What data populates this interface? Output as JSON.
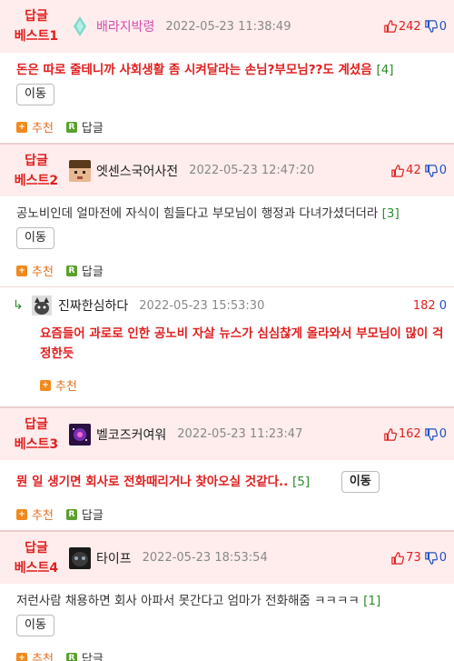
{
  "comments": [
    {
      "badge_line1": "답글",
      "badge_line2": "베스트1",
      "avatar_icon": "diamond-icon",
      "username": "배라지박령",
      "timestamp": "2022-05-23 11:38:49",
      "up": "242",
      "down": "0",
      "text": "돈은 따로 줄테니까 사회생활 좀 시켜달라는 손님?부모님??도 계셨음",
      "reply_count": "[4]",
      "move_label": "이동",
      "recommend_label": "추천",
      "reply_label": "답글"
    },
    {
      "badge_line1": "답글",
      "badge_line2": "베스트2",
      "avatar_icon": "pixel-face-icon",
      "username": "엣센스국어사전",
      "timestamp": "2022-05-23 12:47:20",
      "up": "42",
      "down": "0",
      "text": "공노비인데 얼마전에 자식이 힘들다고 부모님이 행정과 다녀가셨더더라",
      "reply_count": "[3]",
      "move_label": "이동",
      "recommend_label": "추천",
      "reply_label": "답글"
    },
    {
      "badge_line1": "답글",
      "badge_line2": "베스트3",
      "avatar_icon": "galaxy-icon",
      "username": "벨코즈커여워",
      "timestamp": "2022-05-23 11:23:47",
      "up": "162",
      "down": "0",
      "text": "뭔 일 생기면 회사로 전화때리거나 찾아오실 것같다..",
      "reply_count": "[5]",
      "move_label": "이동",
      "recommend_label": "추천",
      "reply_label": "답글"
    },
    {
      "badge_line1": "답글",
      "badge_line2": "베스트4",
      "avatar_icon": "dark-face-icon",
      "username": "타이프",
      "timestamp": "2022-05-23 18:53:54",
      "up": "73",
      "down": "0",
      "text": "저런사람 채용하면 회사 아파서 못간다고 엄마가 전화해줌 ㅋㅋㅋㅋ",
      "reply_count": "[1]",
      "move_label": "이동",
      "recommend_label": "추천",
      "reply_label": "답글"
    }
  ],
  "reply": {
    "avatar_icon": "cat-icon",
    "username": "진짜한심하다",
    "timestamp": "2022-05-23 15:53:30",
    "up": "182",
    "down": "0",
    "text": "요즘들어 과로로 인한 공노비 자살 뉴스가 심심찮게 올라와서 부모님이 많이 걱정한듯",
    "recommend_label": "추천"
  },
  "colors": {
    "header_bg": "#ffecec",
    "accent_red": "#e02020",
    "reply_green": "#2a8c2a",
    "recommend_orange": "#f08a1c",
    "reply_icon_green": "#5aa02c",
    "down_blue": "#2050c0"
  }
}
